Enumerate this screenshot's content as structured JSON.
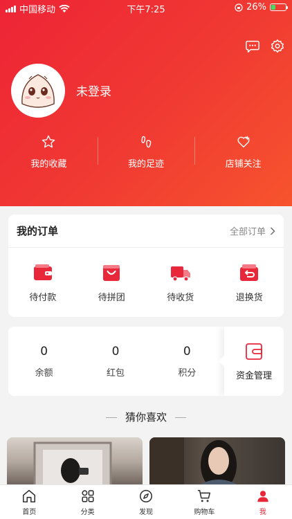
{
  "status_bar": {
    "carrier": "中国移动",
    "time": "下午7:25",
    "battery": "26%"
  },
  "profile": {
    "login_text": "未登录"
  },
  "quick_links": [
    {
      "label": "我的收藏",
      "icon": "star-icon"
    },
    {
      "label": "我的足迹",
      "icon": "footprint-icon"
    },
    {
      "label": "店铺关注",
      "icon": "heart-plus-icon"
    }
  ],
  "orders": {
    "title": "我的订单",
    "all_label": "全部订单",
    "items": [
      {
        "label": "待付款",
        "icon": "wallet-icon"
      },
      {
        "label": "待拼团",
        "icon": "shopping-bag-icon"
      },
      {
        "label": "待收货",
        "icon": "truck-icon"
      },
      {
        "label": "退换货",
        "icon": "return-icon"
      }
    ]
  },
  "assets": {
    "items": [
      {
        "value": "0",
        "label": "余额"
      },
      {
        "value": "0",
        "label": "红包"
      },
      {
        "value": "0",
        "label": "积分"
      }
    ],
    "fund_label": "资金管理"
  },
  "recommend_title": "猜你喜欢",
  "tabbar": [
    {
      "label": "首页",
      "icon": "home-icon",
      "active": false
    },
    {
      "label": "分类",
      "icon": "category-icon",
      "active": false
    },
    {
      "label": "发现",
      "icon": "compass-icon",
      "active": false
    },
    {
      "label": "购物车",
      "icon": "cart-icon",
      "active": false
    },
    {
      "label": "我",
      "icon": "profile-icon",
      "active": true
    }
  ],
  "colors": {
    "brand": "#ee2436",
    "accent_gradient_end": "#f7542e",
    "background": "#f3f3f3"
  }
}
